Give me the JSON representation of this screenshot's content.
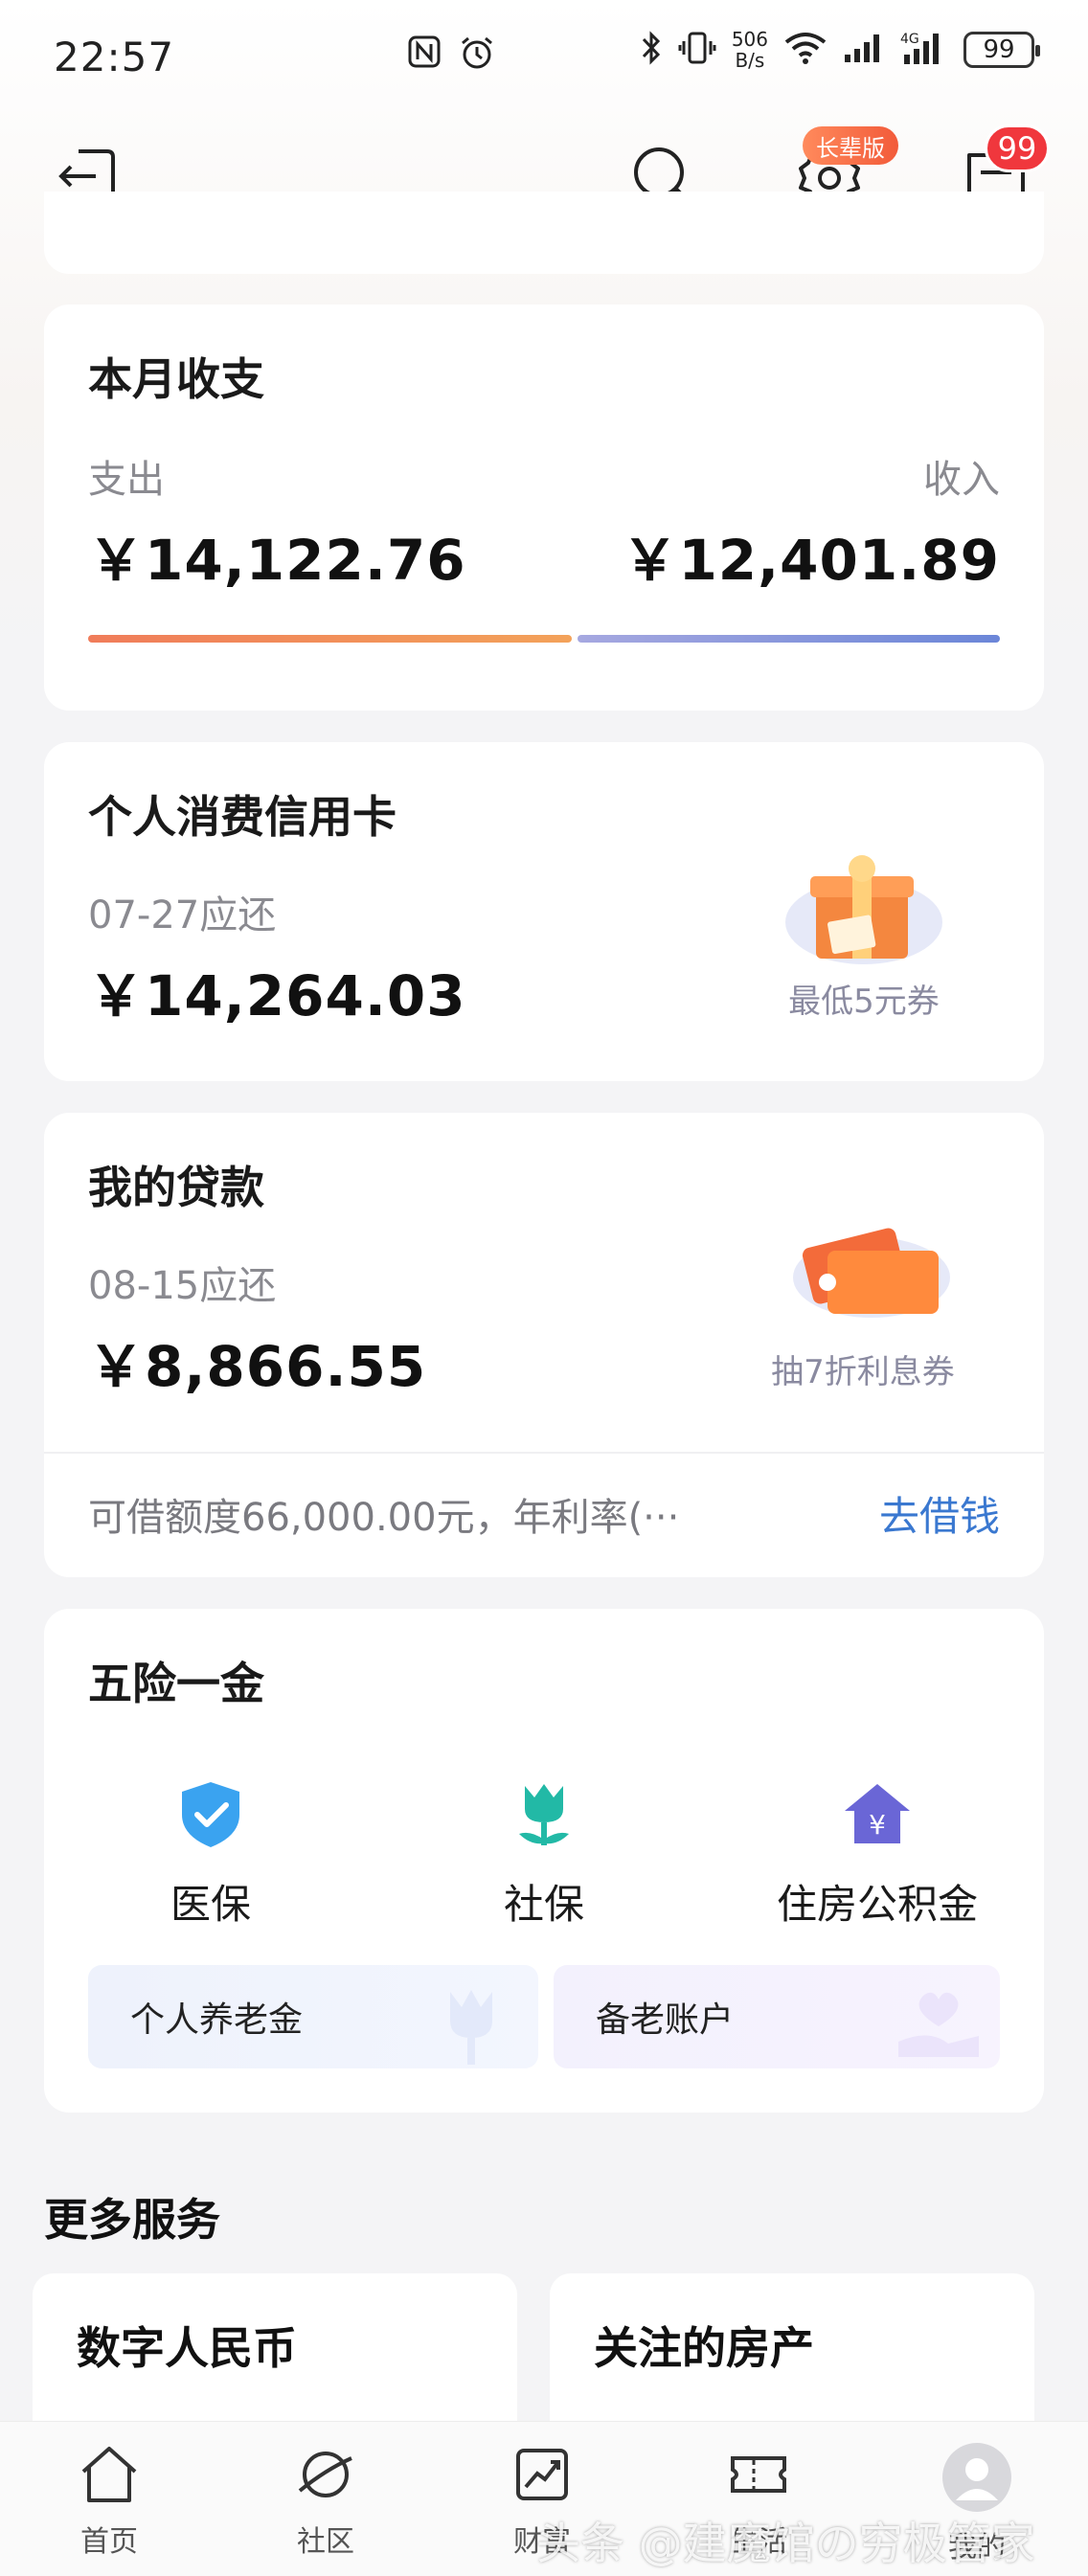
{
  "status_bar": {
    "time": "22:57",
    "net_speed_top": "506",
    "net_speed_bottom": "B/s",
    "battery": "99"
  },
  "top_nav": {
    "elder_badge": "长辈版",
    "message_count": "99"
  },
  "monthly": {
    "title": "本月收支",
    "expense_label": "支出",
    "income_label": "收入",
    "expense_amount": "￥14,122.76",
    "income_amount": "￥12,401.89",
    "expense_ratio": 0.53
  },
  "credit_card": {
    "title": "个人消费信用卡",
    "due_label": "07-27应还",
    "amount": "￥14,264.03",
    "promo": "最低5元券"
  },
  "loan": {
    "title": "我的贷款",
    "due_label": "08-15应还",
    "amount": "￥8,866.55",
    "promo": "抽7折利息券",
    "limit_info": "可借额度66,000.00元，年利率(···",
    "borrow_link": "去借钱"
  },
  "insurance": {
    "title": "五险一金",
    "items": [
      {
        "label": "医保",
        "icon": "shield-check-icon"
      },
      {
        "label": "社保",
        "icon": "tulip-icon"
      },
      {
        "label": "住房公积金",
        "icon": "house-yuan-icon"
      }
    ],
    "pension_personal": "个人养老金",
    "pension_account": "备老账户"
  },
  "more_services": {
    "title": "更多服务",
    "cards": [
      "数字人民币",
      "关注的房产"
    ]
  },
  "tabs": [
    {
      "label": "首页",
      "icon": "home-icon"
    },
    {
      "label": "社区",
      "icon": "planet-icon"
    },
    {
      "label": "财富",
      "icon": "chart-trend-icon"
    },
    {
      "label": "生活",
      "icon": "ticket-icon"
    },
    {
      "label": "我的",
      "icon": "avatar-icon"
    }
  ],
  "watermark": "头条 @建魔馆の穷极管家",
  "colors": {
    "expense_bar": "#f07c5a",
    "income_bar": "#6b86d8",
    "link": "#3a78d0",
    "badge_red": "#f0373d"
  }
}
